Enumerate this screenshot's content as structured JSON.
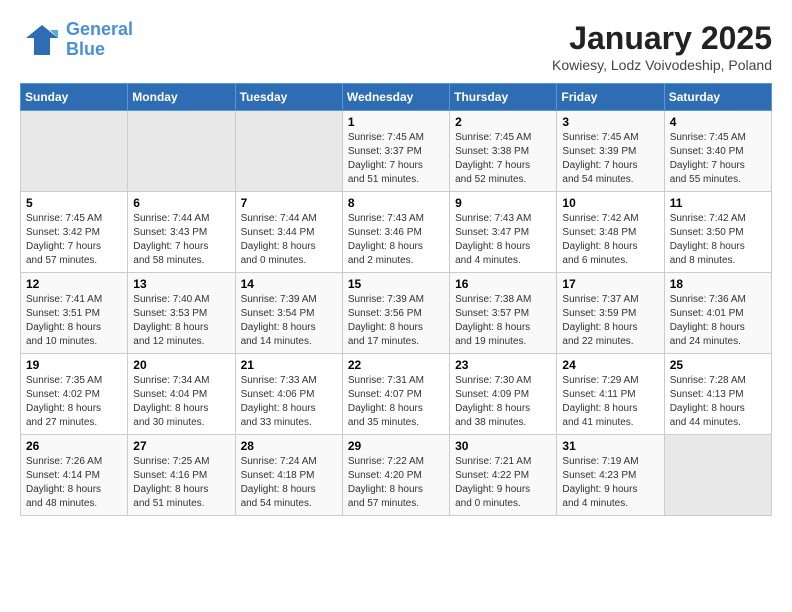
{
  "logo": {
    "line1": "General",
    "line2": "Blue"
  },
  "title": "January 2025",
  "subtitle": "Kowiesy, Lodz Voivodeship, Poland",
  "days_of_week": [
    "Sunday",
    "Monday",
    "Tuesday",
    "Wednesday",
    "Thursday",
    "Friday",
    "Saturday"
  ],
  "weeks": [
    [
      {
        "day": "",
        "info": ""
      },
      {
        "day": "",
        "info": ""
      },
      {
        "day": "",
        "info": ""
      },
      {
        "day": "1",
        "info": "Sunrise: 7:45 AM\nSunset: 3:37 PM\nDaylight: 7 hours\nand 51 minutes."
      },
      {
        "day": "2",
        "info": "Sunrise: 7:45 AM\nSunset: 3:38 PM\nDaylight: 7 hours\nand 52 minutes."
      },
      {
        "day": "3",
        "info": "Sunrise: 7:45 AM\nSunset: 3:39 PM\nDaylight: 7 hours\nand 54 minutes."
      },
      {
        "day": "4",
        "info": "Sunrise: 7:45 AM\nSunset: 3:40 PM\nDaylight: 7 hours\nand 55 minutes."
      }
    ],
    [
      {
        "day": "5",
        "info": "Sunrise: 7:45 AM\nSunset: 3:42 PM\nDaylight: 7 hours\nand 57 minutes."
      },
      {
        "day": "6",
        "info": "Sunrise: 7:44 AM\nSunset: 3:43 PM\nDaylight: 7 hours\nand 58 minutes."
      },
      {
        "day": "7",
        "info": "Sunrise: 7:44 AM\nSunset: 3:44 PM\nDaylight: 8 hours\nand 0 minutes."
      },
      {
        "day": "8",
        "info": "Sunrise: 7:43 AM\nSunset: 3:46 PM\nDaylight: 8 hours\nand 2 minutes."
      },
      {
        "day": "9",
        "info": "Sunrise: 7:43 AM\nSunset: 3:47 PM\nDaylight: 8 hours\nand 4 minutes."
      },
      {
        "day": "10",
        "info": "Sunrise: 7:42 AM\nSunset: 3:48 PM\nDaylight: 8 hours\nand 6 minutes."
      },
      {
        "day": "11",
        "info": "Sunrise: 7:42 AM\nSunset: 3:50 PM\nDaylight: 8 hours\nand 8 minutes."
      }
    ],
    [
      {
        "day": "12",
        "info": "Sunrise: 7:41 AM\nSunset: 3:51 PM\nDaylight: 8 hours\nand 10 minutes."
      },
      {
        "day": "13",
        "info": "Sunrise: 7:40 AM\nSunset: 3:53 PM\nDaylight: 8 hours\nand 12 minutes."
      },
      {
        "day": "14",
        "info": "Sunrise: 7:39 AM\nSunset: 3:54 PM\nDaylight: 8 hours\nand 14 minutes."
      },
      {
        "day": "15",
        "info": "Sunrise: 7:39 AM\nSunset: 3:56 PM\nDaylight: 8 hours\nand 17 minutes."
      },
      {
        "day": "16",
        "info": "Sunrise: 7:38 AM\nSunset: 3:57 PM\nDaylight: 8 hours\nand 19 minutes."
      },
      {
        "day": "17",
        "info": "Sunrise: 7:37 AM\nSunset: 3:59 PM\nDaylight: 8 hours\nand 22 minutes."
      },
      {
        "day": "18",
        "info": "Sunrise: 7:36 AM\nSunset: 4:01 PM\nDaylight: 8 hours\nand 24 minutes."
      }
    ],
    [
      {
        "day": "19",
        "info": "Sunrise: 7:35 AM\nSunset: 4:02 PM\nDaylight: 8 hours\nand 27 minutes."
      },
      {
        "day": "20",
        "info": "Sunrise: 7:34 AM\nSunset: 4:04 PM\nDaylight: 8 hours\nand 30 minutes."
      },
      {
        "day": "21",
        "info": "Sunrise: 7:33 AM\nSunset: 4:06 PM\nDaylight: 8 hours\nand 33 minutes."
      },
      {
        "day": "22",
        "info": "Sunrise: 7:31 AM\nSunset: 4:07 PM\nDaylight: 8 hours\nand 35 minutes."
      },
      {
        "day": "23",
        "info": "Sunrise: 7:30 AM\nSunset: 4:09 PM\nDaylight: 8 hours\nand 38 minutes."
      },
      {
        "day": "24",
        "info": "Sunrise: 7:29 AM\nSunset: 4:11 PM\nDaylight: 8 hours\nand 41 minutes."
      },
      {
        "day": "25",
        "info": "Sunrise: 7:28 AM\nSunset: 4:13 PM\nDaylight: 8 hours\nand 44 minutes."
      }
    ],
    [
      {
        "day": "26",
        "info": "Sunrise: 7:26 AM\nSunset: 4:14 PM\nDaylight: 8 hours\nand 48 minutes."
      },
      {
        "day": "27",
        "info": "Sunrise: 7:25 AM\nSunset: 4:16 PM\nDaylight: 8 hours\nand 51 minutes."
      },
      {
        "day": "28",
        "info": "Sunrise: 7:24 AM\nSunset: 4:18 PM\nDaylight: 8 hours\nand 54 minutes."
      },
      {
        "day": "29",
        "info": "Sunrise: 7:22 AM\nSunset: 4:20 PM\nDaylight: 8 hours\nand 57 minutes."
      },
      {
        "day": "30",
        "info": "Sunrise: 7:21 AM\nSunset: 4:22 PM\nDaylight: 9 hours\nand 0 minutes."
      },
      {
        "day": "31",
        "info": "Sunrise: 7:19 AM\nSunset: 4:23 PM\nDaylight: 9 hours\nand 4 minutes."
      },
      {
        "day": "",
        "info": ""
      }
    ]
  ]
}
